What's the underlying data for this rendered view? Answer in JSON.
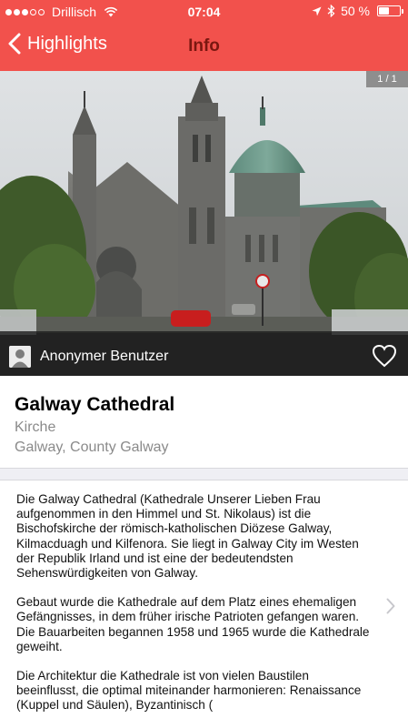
{
  "status_bar": {
    "carrier": "Drillisch",
    "time": "07:04",
    "battery_percent_label": "50 %",
    "battery_level": 0.5
  },
  "nav": {
    "back_label": "Highlights",
    "title": "Info"
  },
  "photo": {
    "counter": "1 / 1",
    "user_name": "Anonymer Benutzer"
  },
  "place": {
    "name": "Galway Cathedral",
    "category": "Kirche",
    "location": "Galway, County Galway"
  },
  "description": {
    "p1": "Die Galway Cathedral (Kathedrale Unserer Lieben Frau aufgenommen in den Himmel und St. Nikolaus) ist die Bischofskirche der römisch-katholischen Diözese Galway, Kilmacduagh und Kilfenora. Sie liegt in Galway City im Westen der Republik Irland und ist eine der bedeutendsten Sehenswürdigkeiten von Galway.",
    "p2": "Gebaut wurde die Kathedrale auf dem Platz eines ehemaligen Gefängnisses, in dem früher irische Patrioten gefangen waren. Die Bauarbeiten begannen 1958 und 1965 wurde die Kathedrale geweiht.",
    "p3": "Die Architektur die Kathedrale ist von vielen Baustilen beeinflusst, die optimal miteinander harmonieren: Renaissance (Kuppel und Säulen), Byzantinisch ("
  },
  "colors": {
    "accent": "#f2514c",
    "nav_title": "#7a1710",
    "secondary_text": "#8a8a8a"
  },
  "icons": [
    "signal-icon",
    "wifi-icon",
    "location-arrow-icon",
    "bluetooth-icon",
    "battery-icon",
    "back-chevron-icon",
    "avatar-icon",
    "heart-icon",
    "chevron-right-icon"
  ]
}
